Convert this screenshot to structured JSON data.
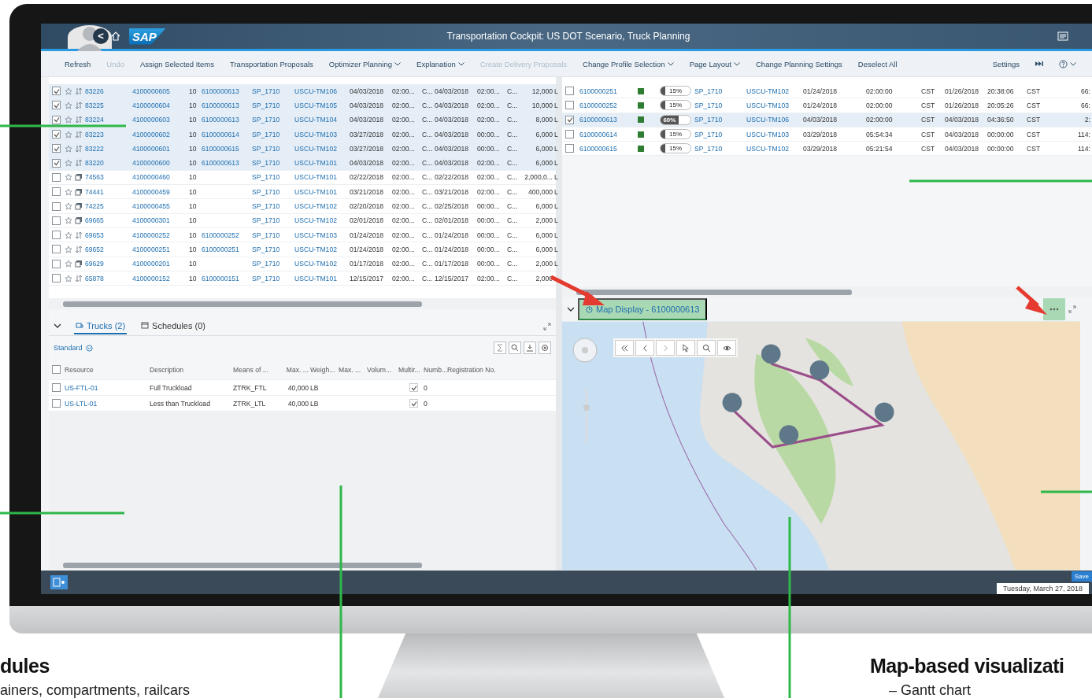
{
  "window": {
    "title": "Transportation Cockpit: US DOT Scenario, Truck Planning",
    "logo": "SAP",
    "back": "<"
  },
  "toolbar": [
    {
      "label": "Refresh",
      "disabled": false,
      "dropdown": false
    },
    {
      "label": "Undo",
      "disabled": true,
      "dropdown": false
    },
    {
      "label": "Assign Selected Items",
      "disabled": false,
      "dropdown": false
    },
    {
      "label": "Transportation Proposals",
      "disabled": false,
      "dropdown": false
    },
    {
      "label": "Optimizer Planning",
      "disabled": false,
      "dropdown": true
    },
    {
      "label": "Explanation",
      "disabled": false,
      "dropdown": true
    },
    {
      "label": "Create Delivery Proposals",
      "disabled": true,
      "dropdown": false
    },
    {
      "label": "Change Profile Selection",
      "disabled": false,
      "dropdown": true
    },
    {
      "label": "Page Layout",
      "disabled": false,
      "dropdown": true
    },
    {
      "label": "Change Planning Settings",
      "disabled": false,
      "dropdown": false
    },
    {
      "label": "Deselect All",
      "disabled": false,
      "dropdown": false
    }
  ],
  "toolbar_right": {
    "settings": "Settings"
  },
  "requirements": [
    {
      "checked": true,
      "kind": "transfer",
      "number": "83226",
      "document": "4100000605",
      "item": "10",
      "freight_order": "6100000613",
      "location": "SP_1710",
      "resource": "USCU-TM106",
      "start_date": "04/03/2018",
      "start_time": "02:00...",
      "start_zone": "C...",
      "end_date": "04/03/2018",
      "end_time": "02:00...",
      "end_zone": "C...",
      "quantity": "12,000",
      "unit": "L"
    },
    {
      "checked": true,
      "kind": "transfer",
      "number": "83225",
      "document": "4100000604",
      "item": "10",
      "freight_order": "6100000613",
      "location": "SP_1710",
      "resource": "USCU-TM105",
      "start_date": "04/03/2018",
      "start_time": "02:00...",
      "start_zone": "C...",
      "end_date": "04/03/2018",
      "end_time": "02:00...",
      "end_zone": "C...",
      "quantity": "10,000",
      "unit": "L"
    },
    {
      "checked": true,
      "kind": "transfer",
      "number": "83224",
      "document": "4100000603",
      "item": "10",
      "freight_order": "6100000613",
      "location": "SP_1710",
      "resource": "USCU-TM104",
      "start_date": "04/03/2018",
      "start_time": "02:00...",
      "start_zone": "C...",
      "end_date": "04/03/2018",
      "end_time": "02:00...",
      "end_zone": "C...",
      "quantity": "8,000",
      "unit": "L"
    },
    {
      "checked": true,
      "kind": "transfer",
      "number": "83223",
      "document": "4100000602",
      "item": "10",
      "freight_order": "6100000614",
      "location": "SP_1710",
      "resource": "USCU-TM103",
      "start_date": "03/27/2018",
      "start_time": "02:00...",
      "start_zone": "C...",
      "end_date": "04/03/2018",
      "end_time": "00:00...",
      "end_zone": "C...",
      "quantity": "6,000",
      "unit": "L"
    },
    {
      "checked": true,
      "kind": "transfer",
      "number": "83222",
      "document": "4100000601",
      "item": "10",
      "freight_order": "6100000615",
      "location": "SP_1710",
      "resource": "USCU-TM102",
      "start_date": "03/27/2018",
      "start_time": "02:00...",
      "start_zone": "C...",
      "end_date": "04/03/2018",
      "end_time": "00:00...",
      "end_zone": "C...",
      "quantity": "6,000",
      "unit": "L"
    },
    {
      "checked": true,
      "kind": "transfer",
      "number": "83220",
      "document": "4100000600",
      "item": "10",
      "freight_order": "6100000613",
      "location": "SP_1710",
      "resource": "USCU-TM101",
      "start_date": "04/03/2018",
      "start_time": "02:00...",
      "start_zone": "C...",
      "end_date": "04/03/2018",
      "end_time": "02:00...",
      "end_zone": "C...",
      "quantity": "6,000",
      "unit": "L"
    },
    {
      "checked": false,
      "kind": "document",
      "number": "74563",
      "document": "4100000460",
      "item": "10",
      "location": "SP_1710",
      "resource": "USCU-TM101",
      "start_date": "02/22/2018",
      "start_time": "02:00...",
      "start_zone": "C...",
      "end_date": "02/22/2018",
      "end_time": "02:00...",
      "end_zone": "C...",
      "quantity": "2,000,0...",
      "unit": "L"
    },
    {
      "checked": false,
      "kind": "document",
      "number": "74441",
      "document": "4100000459",
      "item": "10",
      "location": "SP_1710",
      "resource": "USCU-TM101",
      "start_date": "03/21/2018",
      "start_time": "02:00...",
      "start_zone": "C...",
      "end_date": "03/21/2018",
      "end_time": "02:00...",
      "end_zone": "C...",
      "quantity": "400,000",
      "unit": "L"
    },
    {
      "checked": false,
      "kind": "document",
      "number": "74225",
      "document": "4100000455",
      "item": "10",
      "location": "SP_1710",
      "resource": "USCU-TM102",
      "start_date": "02/20/2018",
      "start_time": "02:00...",
      "start_zone": "C...",
      "end_date": "02/25/2018",
      "end_time": "00:00...",
      "end_zone": "C...",
      "quantity": "6,000",
      "unit": "L"
    },
    {
      "checked": false,
      "kind": "document",
      "number": "69665",
      "document": "4100000301",
      "item": "10",
      "location": "SP_1710",
      "resource": "USCU-TM102",
      "start_date": "02/01/2018",
      "start_time": "02:00...",
      "start_zone": "C...",
      "end_date": "02/01/2018",
      "end_time": "00:00...",
      "end_zone": "C...",
      "quantity": "2,000",
      "unit": "L"
    },
    {
      "checked": false,
      "kind": "transfer",
      "number": "69653",
      "document": "4100000252",
      "item": "10",
      "freight_order": "6100000252",
      "location": "SP_1710",
      "resource": "USCU-TM103",
      "start_date": "01/24/2018",
      "start_time": "02:00...",
      "start_zone": "C...",
      "end_date": "01/24/2018",
      "end_time": "00:00...",
      "end_zone": "C...",
      "quantity": "6,000",
      "unit": "L"
    },
    {
      "checked": false,
      "kind": "transfer",
      "number": "69652",
      "document": "4100000251",
      "item": "10",
      "freight_order": "6100000251",
      "location": "SP_1710",
      "resource": "USCU-TM102",
      "start_date": "01/24/2018",
      "start_time": "02:00...",
      "start_zone": "C...",
      "end_date": "01/24/2018",
      "end_time": "00:00...",
      "end_zone": "C...",
      "quantity": "6,000",
      "unit": "L"
    },
    {
      "checked": false,
      "kind": "document",
      "number": "69629",
      "document": "4100000201",
      "item": "10",
      "location": "SP_1710",
      "resource": "USCU-TM102",
      "start_date": "01/17/2018",
      "start_time": "02:00...",
      "start_zone": "C...",
      "end_date": "01/17/2018",
      "end_time": "00:00...",
      "end_zone": "C...",
      "quantity": "2,000",
      "unit": "L"
    },
    {
      "checked": false,
      "kind": "transfer",
      "number": "65878",
      "document": "4100000152",
      "item": "10",
      "freight_order": "6100000151",
      "location": "SP_1710",
      "resource": "USCU-TM101",
      "start_date": "12/15/2017",
      "start_time": "02:00...",
      "start_zone": "C...",
      "end_date": "12/15/2017",
      "end_time": "02:00...",
      "end_zone": "C...",
      "quantity": "2,000"
    }
  ],
  "freight_orders": [
    {
      "checked": false,
      "number": "6100000251",
      "color": "#2e7d32",
      "level": 0.15,
      "reading": "15%",
      "location": "SP_1710",
      "resource": "USCU-TM102",
      "start_date": "01/24/2018",
      "start_time": "02:00:00",
      "start_zone": "CST",
      "end_date": "01/26/2018",
      "end_time": "20:38:06",
      "end_zone": "CST",
      "column_13": "66:"
    },
    {
      "checked": false,
      "number": "6100000252",
      "color": "#2e7d32",
      "level": 0.15,
      "reading": "15%",
      "location": "SP_1710",
      "resource": "USCU-TM103",
      "start_date": "01/24/2018",
      "start_time": "02:00:00",
      "start_zone": "CST",
      "end_date": "01/26/2018",
      "end_time": "20:05:26",
      "end_zone": "CST",
      "column_13": "66:"
    },
    {
      "checked": true,
      "number": "6100000613",
      "color": "#2e7d32",
      "level": 0.6,
      "reading": "60%",
      "location": "SP_1710",
      "resource": "USCU-TM106",
      "start_date": "04/03/2018",
      "start_time": "02:00:00",
      "start_zone": "CST",
      "end_date": "04/03/2018",
      "end_time": "04:36:50",
      "end_zone": "CST",
      "column_13": "2:"
    },
    {
      "checked": false,
      "number": "6100000614",
      "color": "#2e7d32",
      "level": 0.15,
      "reading": "15%",
      "location": "SP_1710",
      "resource": "USCU-TM103",
      "start_date": "03/29/2018",
      "start_time": "05:54:34",
      "start_zone": "CST",
      "end_date": "04/03/2018",
      "end_time": "00:00:00",
      "end_zone": "CST",
      "column_13": "114:"
    },
    {
      "checked": false,
      "number": "6100000615",
      "color": "#2e7d32",
      "level": 0.15,
      "reading": "15%",
      "location": "SP_1710",
      "resource": "USCU-TM102",
      "start_date": "03/29/2018",
      "start_time": "05:21:54",
      "start_zone": "CST",
      "end_date": "04/03/2018",
      "end_time": "00:00:00",
      "end_zone": "CST",
      "column_13": "114:"
    }
  ],
  "resources_panel": {
    "tabs": [
      {
        "label": "Trucks (2)",
        "selected": true
      },
      {
        "label": "Schedules (0)",
        "selected": false
      }
    ],
    "variant": "Standard",
    "select_all_checked": false,
    "columns": [
      "Resource",
      "Description",
      "Means of ...",
      "Max. ...",
      "Weigh...",
      "Max. ...",
      "Volum...",
      "Multir...",
      "Numb...",
      "Registration No."
    ],
    "rows": [
      {
        "checked": false,
        "resource": "US-FTL-01",
        "description": "Full Truckload",
        "means": "ZTRK_FTL",
        "max_weight": "40,000",
        "weight_unit": "LB",
        "multi": true,
        "number": "0"
      },
      {
        "checked": false,
        "resource": "US-LTL-01",
        "description": "Less than Truckload",
        "means": "ZTRK_LTL",
        "max_weight": "40,000",
        "weight_unit": "LB",
        "multi": true,
        "number": "0"
      }
    ]
  },
  "map_panel": {
    "title": "Map Display - 6100000613"
  },
  "footer": {
    "save": "Save",
    "date": "Tuesday, March 27, 2018"
  },
  "callouts": [
    {
      "title": "dules",
      "text": "ainers, compartments, railcars"
    },
    {
      "title": "Map-based visualizati",
      "text": "– Gantt chart"
    }
  ]
}
